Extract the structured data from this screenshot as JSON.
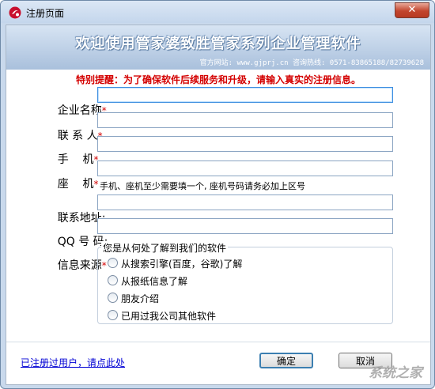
{
  "window": {
    "title": "注册页面",
    "close_symbol": "✕"
  },
  "banner": {
    "title": "欢迎使用管家婆致胜管家系列企业管理软件",
    "contact": "官方网站: www.gjprj.cn 咨询热线: 0571-83865188/82739628"
  },
  "reminder": "特别提醒：为了确保软件后续服务和升级，请输入真实的注册信息。",
  "form": {
    "company_label": "企业名称",
    "company_value": "",
    "contact_label": "联 系 人",
    "contact_value": "",
    "mobile_label": "手    机",
    "mobile_value": "",
    "phone_label": "座    机",
    "phone_value": "",
    "phone_hint": "手机、座机至少需要填一个, 座机号码请务必加上区号",
    "address_label": "联系地址",
    "address_value": "",
    "qq_label": "QQ 号 码",
    "qq_value": "",
    "source_label": "信息来源",
    "required_mark": "*",
    "colon": ":"
  },
  "source_group": {
    "title": "您是从何处了解到我们的软件",
    "options": [
      "从搜索引擎(百度，谷歌)了解",
      "从报纸信息了解",
      "朋友介绍",
      "已用过我公司其他软件"
    ]
  },
  "footer": {
    "registered_link": "已注册过用户，请点此处",
    "ok_label": "确定",
    "cancel_label": "取消"
  },
  "watermark": "系统之家",
  "colors": {
    "accent": "#3d8ee0",
    "required": "#d40000",
    "link": "#0000d4"
  }
}
